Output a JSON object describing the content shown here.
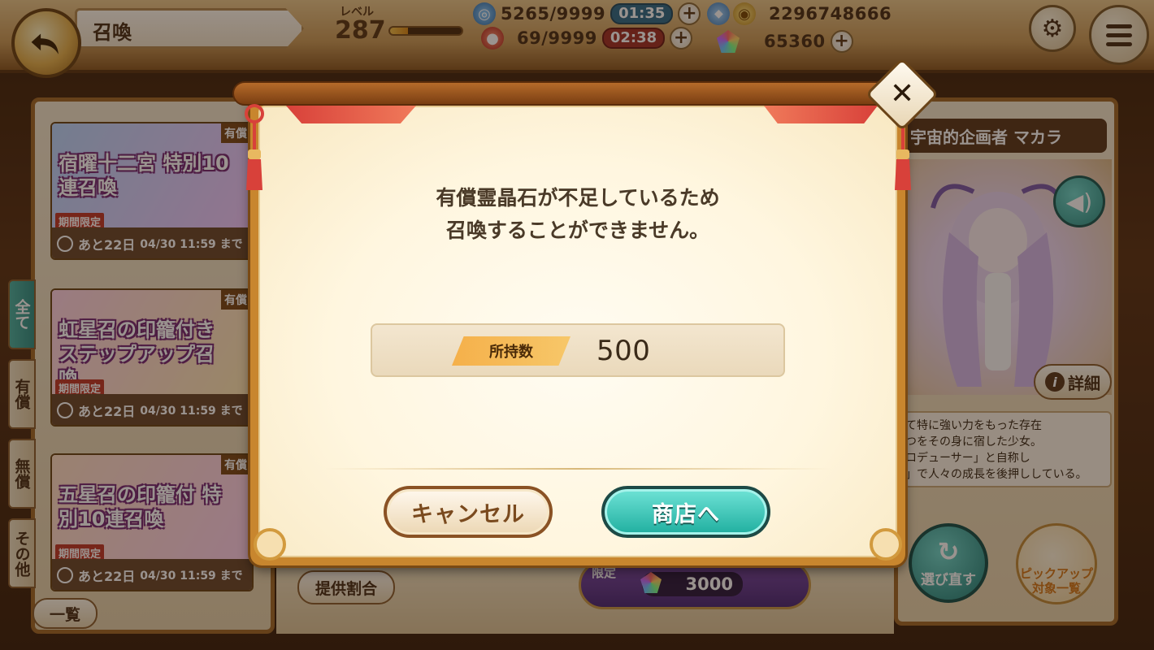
{
  "header": {
    "title": "召喚",
    "level_label": "レベル",
    "level_value": "287",
    "level_progress": 0.25,
    "stamina": "5265/9999",
    "stamina_timer": "01:35",
    "ap": "69/9999",
    "ap_timer": "02:38",
    "gold": "2296748666",
    "gems": "65360",
    "plus_label": "+"
  },
  "banners": [
    {
      "title": "宿曜十二宮 特別10連召喚",
      "limited": "期間限定",
      "paid": "有償",
      "remaining": "あと22日",
      "end": "04/30 11:59 まで",
      "color_a": "#b9d8ff",
      "color_b": "#f2c8ff"
    },
    {
      "title": "虹星召の印籠付き ステップアップ召喚",
      "limited": "期間限定",
      "paid": "有償",
      "remaining": "あと22日",
      "end": "04/30 11:59 まで",
      "color_a": "#ffd3e6",
      "color_b": "#ffe9b5"
    },
    {
      "title": "五星召の印籠付 特別10連召喚",
      "limited": "期間限定",
      "paid": "有償",
      "remaining": "あと22日",
      "end": "04/30 11:59 まで",
      "color_a": "#ffe0c7",
      "color_b": "#ffd0ee"
    }
  ],
  "side_tabs": [
    "全て",
    "有償",
    "無償",
    "その他"
  ],
  "list_button": "一覧",
  "rate_button": "提供割合",
  "cost": {
    "limited": "限定",
    "value": "3000"
  },
  "character": {
    "name": "宇宙的企画者 マカラ",
    "detail_label": "詳細",
    "desc_lines": [
      "て特に強い力をもった存在",
      "つをその身に宿した少女。",
      "ロデューサー」と自称し",
      "」で人々の成長を後押ししている。"
    ],
    "reroll_label": "選び直す",
    "pickup_label": "ピックアップ対象一覧"
  },
  "dialog": {
    "message_line1": "有償霊晶石が不足しているため",
    "message_line2": "召喚することができません。",
    "owned_label": "所持数",
    "owned_value": "500",
    "cancel_label": "キャンセル",
    "shop_label": "商店へ"
  },
  "colors": {
    "teal_button": "#1fae9f",
    "cancel_border": "#8a5224",
    "frame_gold": "#c8862e",
    "ribbon_red": "#d8413a"
  }
}
